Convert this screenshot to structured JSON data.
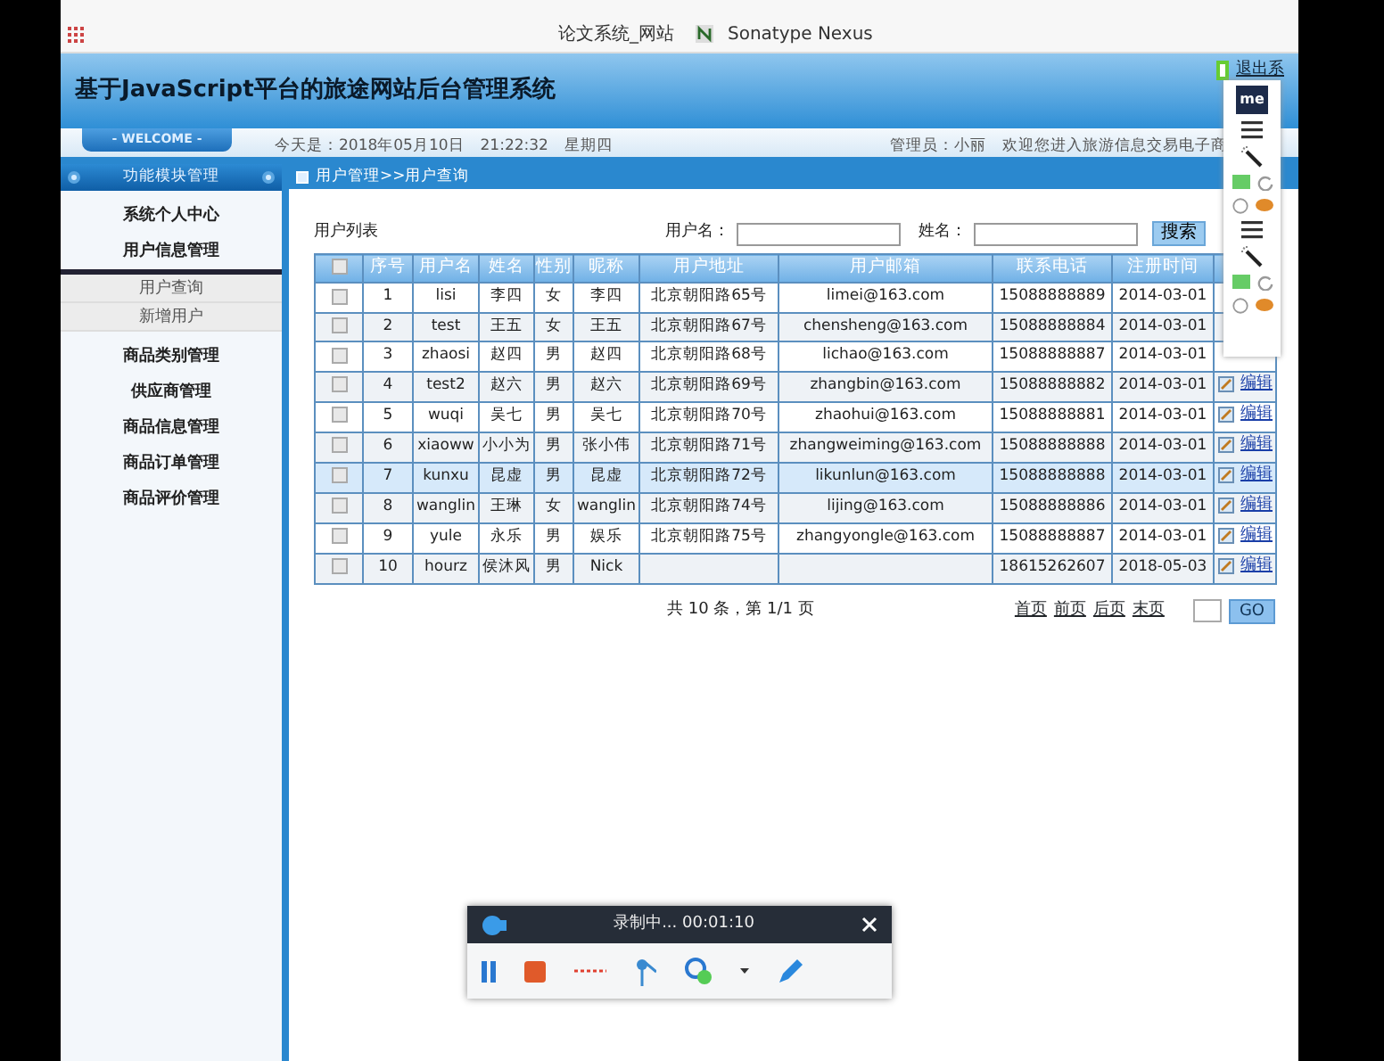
{
  "bookmarks_bar": {
    "items": [
      {
        "label": "论文系统_网站"
      },
      {
        "label": "Sonatype Nexus"
      }
    ]
  },
  "header": {
    "title": "基于JavaScript平台的旅途网站后台管理系统",
    "logout": "退出系"
  },
  "welcome_bar": {
    "tab": "- WELCOME -",
    "date": "今天是：2018年05月10日　21:22:32　星期四",
    "admin": "管理员：小丽　欢迎您进入旅游信息交易电子商"
  },
  "sidebar": {
    "title": "功能模块管理",
    "items": [
      {
        "label": "系统个人中心"
      },
      {
        "label": "用户信息管理",
        "expanded": true,
        "children": [
          {
            "label": "用户查询"
          },
          {
            "label": "新增用户"
          }
        ]
      },
      {
        "label": "商品类别管理"
      },
      {
        "label": "供应商管理"
      },
      {
        "label": "商品信息管理"
      },
      {
        "label": "商品订单管理"
      },
      {
        "label": "商品评价管理"
      }
    ]
  },
  "breadcrumb": "用户管理>>用户查询",
  "list_title": "用户列表",
  "search": {
    "fields": [
      {
        "label": "用户名："
      },
      {
        "label": "姓名："
      }
    ],
    "button": "搜索"
  },
  "table": {
    "select_all_checked": false,
    "columns": [
      "序号",
      "用户名",
      "姓名",
      "性别",
      "昵称",
      "用户地址",
      "用户邮箱",
      "联系电话",
      "注册时间"
    ],
    "rows": [
      {
        "checked": false,
        "hovered": false,
        "no": "1",
        "username": "lisi",
        "name": "李四",
        "gender": "女",
        "nickname": "李四",
        "address": "北京朝阳路65号",
        "email": "limei@163.com",
        "phone": "15088888889",
        "date": "2014-03-01"
      },
      {
        "checked": false,
        "hovered": false,
        "no": "2",
        "username": "test",
        "name": "王五",
        "gender": "女",
        "nickname": "王五",
        "address": "北京朝阳路67号",
        "email": "chensheng@163.com",
        "phone": "15088888884",
        "date": "2014-03-01"
      },
      {
        "checked": false,
        "hovered": false,
        "no": "3",
        "username": "zhaosi",
        "name": "赵四",
        "gender": "男",
        "nickname": "赵四",
        "address": "北京朝阳路68号",
        "email": "lichao@163.com",
        "phone": "15088888887",
        "date": "2014-03-01"
      },
      {
        "checked": false,
        "hovered": false,
        "no": "4",
        "username": "test2",
        "name": "赵六",
        "gender": "男",
        "nickname": "赵六",
        "address": "北京朝阳路69号",
        "email": "zhangbin@163.com",
        "phone": "15088888882",
        "date": "2014-03-01",
        "action": "编辑"
      },
      {
        "checked": false,
        "hovered": false,
        "no": "5",
        "username": "wuqi",
        "name": "吴七",
        "gender": "男",
        "nickname": "吴七",
        "address": "北京朝阳路70号",
        "email": "zhaohui@163.com",
        "phone": "15088888881",
        "date": "2014-03-01",
        "action": "编辑"
      },
      {
        "checked": false,
        "hovered": false,
        "no": "6",
        "username": "xiaoww",
        "name": "小小为",
        "gender": "男",
        "nickname": "张小伟",
        "address": "北京朝阳路71号",
        "email": "zhangweiming@163.com",
        "phone": "15088888888",
        "date": "2014-03-01",
        "action": "编辑"
      },
      {
        "checked": false,
        "hovered": true,
        "no": "7",
        "username": "kunxu",
        "name": "昆虚",
        "gender": "男",
        "nickname": "昆虚",
        "address": "北京朝阳路72号",
        "email": "likunlun@163.com",
        "phone": "15088888888",
        "date": "2014-03-01",
        "action": "编辑"
      },
      {
        "checked": false,
        "hovered": false,
        "no": "8",
        "username": "wanglin",
        "name": "王琳",
        "gender": "女",
        "nickname": "wanglin",
        "address": "北京朝阳路74号",
        "email": "lijing@163.com",
        "phone": "15088888886",
        "date": "2014-03-01",
        "action": "编辑"
      },
      {
        "checked": false,
        "hovered": false,
        "no": "9",
        "username": "yule",
        "name": "永乐",
        "gender": "男",
        "nickname": "娱乐",
        "address": "北京朝阳路75号",
        "email": "zhangyongle@163.com",
        "phone": "15088888887",
        "date": "2014-03-01",
        "action": "编辑"
      },
      {
        "checked": false,
        "hovered": false,
        "no": "10",
        "username": "hourz",
        "name": "侯沐风",
        "gender": "男",
        "nickname": "Nick",
        "phone": "18615262607",
        "date": "2018-05-03",
        "action": "编辑"
      }
    ]
  },
  "pagination": {
    "summary": "共 10 条，第 1/1 页",
    "links": [
      "首页",
      "前页",
      "后页",
      "末页"
    ],
    "go": "GO"
  },
  "extension_panel": {
    "logo": "me"
  },
  "recorder": {
    "status": "录制中... 00:01:10"
  }
}
